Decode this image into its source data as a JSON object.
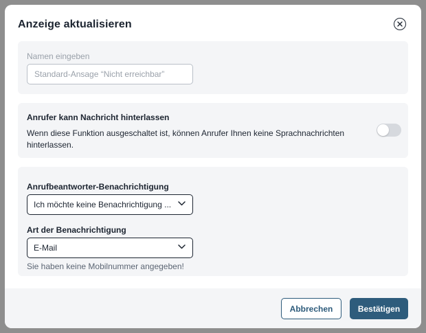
{
  "dialog": {
    "title": "Anzeige aktualisieren"
  },
  "name_section": {
    "label": "Namen eingeben",
    "placeholder": "Standard-Ansage “Nicht erreichbar”",
    "value": ""
  },
  "voicemail_section": {
    "title": "Anrufer kann Nachricht hinterlassen",
    "description": "Wenn diese Funktion ausgeschaltet ist, können Anrufer Ihnen keine Sprachnachrichten hinterlassen.",
    "toggle_on": false
  },
  "notification_section": {
    "notify_label": "Anrufbeantworter-Benachrichtigung",
    "notify_value": "Ich möchte keine Benachrichtigung ...",
    "type_label": "Art der Benachrichtigung",
    "type_value": "E-Mail",
    "hint": "Sie haben keine Mobilnummer angegeben!"
  },
  "footer": {
    "cancel_label": "Abbrechen",
    "confirm_label": "Bestätigen"
  },
  "colors": {
    "primary": "#2e5c7c",
    "text": "#1c2430",
    "section_bg": "#f4f5f7",
    "toggle_off": "#d6d9de"
  },
  "icons": {
    "close": "close-icon",
    "chevron": "chevron-down-icon"
  }
}
